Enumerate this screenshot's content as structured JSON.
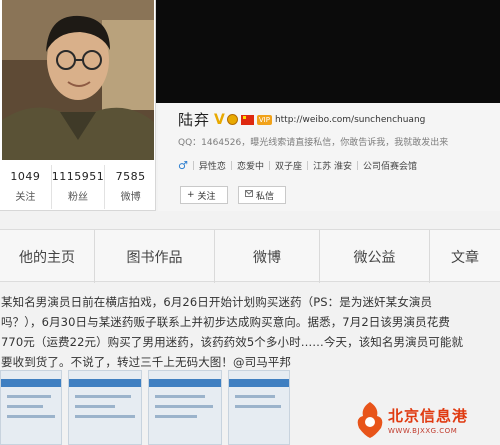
{
  "header": {
    "stats": [
      {
        "value": "1049",
        "label": "关注"
      },
      {
        "value": "1115951",
        "label": "粉丝"
      },
      {
        "value": "7585",
        "label": "微博"
      }
    ]
  },
  "profile": {
    "name": "陆弃",
    "verified_mark": "V",
    "vip_label": "VIP",
    "home_url": "http://weibo.com/sunchenchuang",
    "qq_line": "QQ：1464526，曝光线索请直接私信，你敢告诉我，我就敢发出来",
    "gender_icon": "♂",
    "tags": [
      "异性恋",
      "恋爱中",
      "双子座",
      "江苏 淮安",
      "公司佰赛会馆"
    ],
    "follow_label": "关注",
    "follow_icon": "+",
    "message_label": "私信"
  },
  "tabs": [
    "他的主页",
    "图书作品",
    "微博",
    "微公益",
    "文章"
  ],
  "post": {
    "lines": [
      "某知名男演员日前在横店拍戏，6月26日开始计划购买迷药（PS：是为迷奸某女演员",
      "吗？），6月30日与某迷药贩子联系上并初步达成购买意向。据悉，7月2日该男演员花费",
      "770元（运费22元）购买了男用迷药，该药药效5个多小时……今天，该知名男演员可能就",
      "要收到货了。不说了，转过三千上无码大图！"
    ],
    "mention": "@司马平邦"
  },
  "watermark": {
    "name": "北京信息港",
    "url": "WWW.BJXXG.COM"
  },
  "colors": {
    "banner": "#0b0b0b",
    "verified": "#e8a900",
    "gender": "#2d7fd0",
    "watermark": "#e03a10"
  }
}
